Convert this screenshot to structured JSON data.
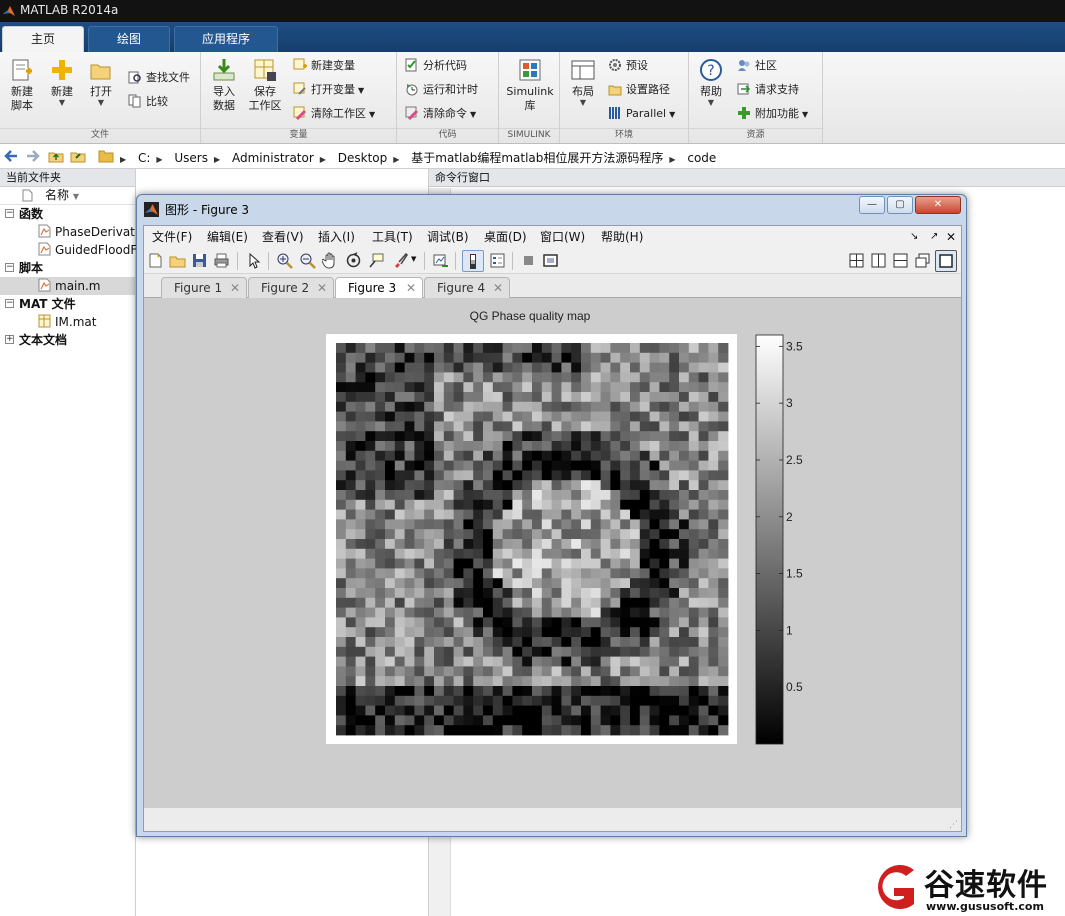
{
  "app": {
    "title": "MATLAB R2014a"
  },
  "ribbon": {
    "tabs": [
      "主页",
      "绘图",
      "应用程序"
    ],
    "groups": {
      "file": {
        "label": "文件",
        "new_script": "新建\n脚本",
        "new": "新建",
        "open": "打开",
        "find_files": "查找文件",
        "compare": "比较"
      },
      "variable": {
        "label": "变量",
        "import_data": "导入\n数据",
        "save_workspace": "保存\n工作区",
        "new_variable": "新建变量",
        "open_variable": "打开变量",
        "clear_workspace": "清除工作区"
      },
      "code": {
        "label": "代码",
        "analyze_code": "分析代码",
        "run_and_time": "运行和计时",
        "clear_commands": "清除命令"
      },
      "simulink": {
        "label": "SIMULINK",
        "library": "Simulink\n库"
      },
      "environment": {
        "label": "环境",
        "layout": "布局",
        "preferences": "预设",
        "set_path": "设置路径",
        "parallel": "Parallel"
      },
      "resources": {
        "label": "资源",
        "help": "帮助",
        "community": "社区",
        "request_support": "请求支持",
        "add_ons": "附加功能"
      }
    }
  },
  "address": {
    "crumbs": [
      "C:",
      "Users",
      "Administrator",
      "Desktop",
      "基于matlab编程matlab相位展开方法源码程序",
      "code"
    ]
  },
  "current_folder": {
    "title": "当前文件夹",
    "column_name": "名称",
    "groups": [
      {
        "label": "函数",
        "expanded": true,
        "items": [
          "PhaseDerivativeVariance.m",
          "GuidedFloodFill.m"
        ]
      },
      {
        "label": "脚本",
        "expanded": true,
        "items": [
          "main.m"
        ]
      },
      {
        "label": "MAT 文件",
        "expanded": true,
        "items": [
          "IM.mat"
        ]
      },
      {
        "label": "文本文档",
        "expanded": false,
        "items": []
      }
    ]
  },
  "command_window": {
    "title": "命令行窗口"
  },
  "figure_window": {
    "title": "图形 - Figure 3",
    "menu": [
      "文件(F)",
      "编辑(E)",
      "查看(V)",
      "插入(I)",
      "工具(T)",
      "调试(B)",
      "桌面(D)",
      "窗口(W)",
      "帮助(H)"
    ],
    "tabs": [
      "Figure 1",
      "Figure 2",
      "Figure 3",
      "Figure 4"
    ],
    "active_tab": "Figure 3"
  },
  "chart_data": {
    "type": "heatmap",
    "title": "QG Phase quality map",
    "xlabel": "",
    "ylabel": "",
    "colormap": "gray",
    "colorbar": {
      "range": [
        0,
        3.6
      ],
      "ticks": [
        "0.5",
        "1",
        "1.5",
        "2",
        "2.5",
        "3",
        "3.5"
      ]
    },
    "grid": false
  },
  "watermark": {
    "brand": "谷速软件",
    "url": "www.gususoft.com",
    "color": "#d01f1f"
  }
}
